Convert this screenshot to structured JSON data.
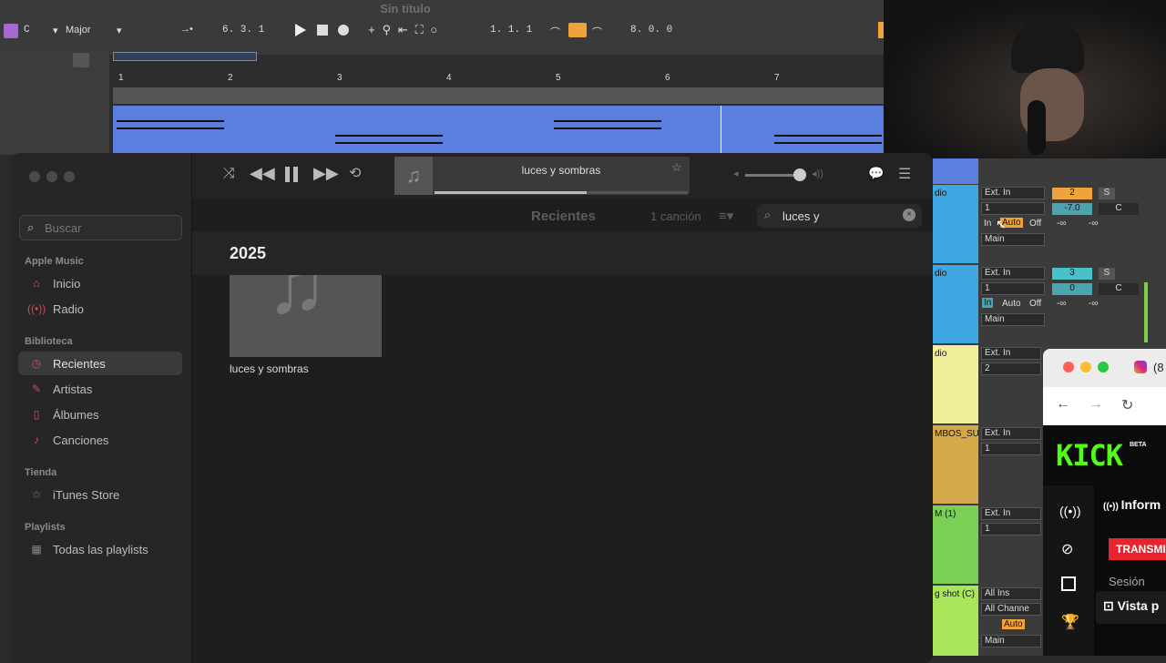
{
  "ableton": {
    "title": "Sin título",
    "key": "C",
    "scale": "Major",
    "position": "6.  3.  1",
    "loop_start": "1.  1.  1",
    "loop_len": "8.  0.  0",
    "bars": [
      "1",
      "2",
      "3",
      "4",
      "5",
      "6",
      "7"
    ]
  },
  "music": {
    "search_placeholder": "Buscar",
    "sections": [
      {
        "title": "Apple Music",
        "items": [
          {
            "label": "Inicio",
            "icon": "house-icon"
          },
          {
            "label": "Radio",
            "icon": "radio-icon"
          }
        ]
      },
      {
        "title": "Biblioteca",
        "items": [
          {
            "label": "Recientes",
            "icon": "clock-icon"
          },
          {
            "label": "Artistas",
            "icon": "microphone-icon"
          },
          {
            "label": "Álbumes",
            "icon": "album-icon"
          },
          {
            "label": "Canciones",
            "icon": "note-icon"
          }
        ]
      },
      {
        "title": "Tienda",
        "items": [
          {
            "label": "iTunes Store",
            "icon": "star-icon"
          }
        ]
      },
      {
        "title": "Playlists",
        "items": [
          {
            "label": "Todas las playlists",
            "icon": "grid-icon"
          }
        ]
      }
    ],
    "now_playing": "luces y sombras",
    "progress": 0.6,
    "view_title": "Recientes",
    "count": "1 canción",
    "search_value": "luces y",
    "year": "2025",
    "album_title": "luces y sombras"
  },
  "mixer": {
    "tracks": [
      {
        "name": "dio",
        "input": "Ext. In",
        "ch": "1",
        "num": "2",
        "vol": "-7.0",
        "pan": "C",
        "inf": "-∞"
      },
      {
        "name": "dio",
        "input": "Ext. In",
        "ch": "1",
        "num": "3",
        "vol": "0",
        "pan": "C",
        "inf": "-∞"
      },
      {
        "name": "dio",
        "input": "Ext. In",
        "ch": "2"
      },
      {
        "name": "MBOS_SU",
        "input": "Ext. In",
        "ch": "1"
      },
      {
        "name": "M (1)",
        "input": "Ext. In",
        "ch": "1"
      },
      {
        "name": "g shot (C)",
        "input": "All Ins",
        "ch": "All Channe"
      }
    ],
    "in": "In",
    "auto": "Auto",
    "off": "Off",
    "main": "Main",
    "s": "S"
  },
  "browser": {
    "logo": "KICK",
    "beta": "BETA",
    "info": "Inform",
    "live_btn": "TRANSMI",
    "session": "Sesión",
    "preview": "Vista p",
    "tab_count": "(8"
  }
}
